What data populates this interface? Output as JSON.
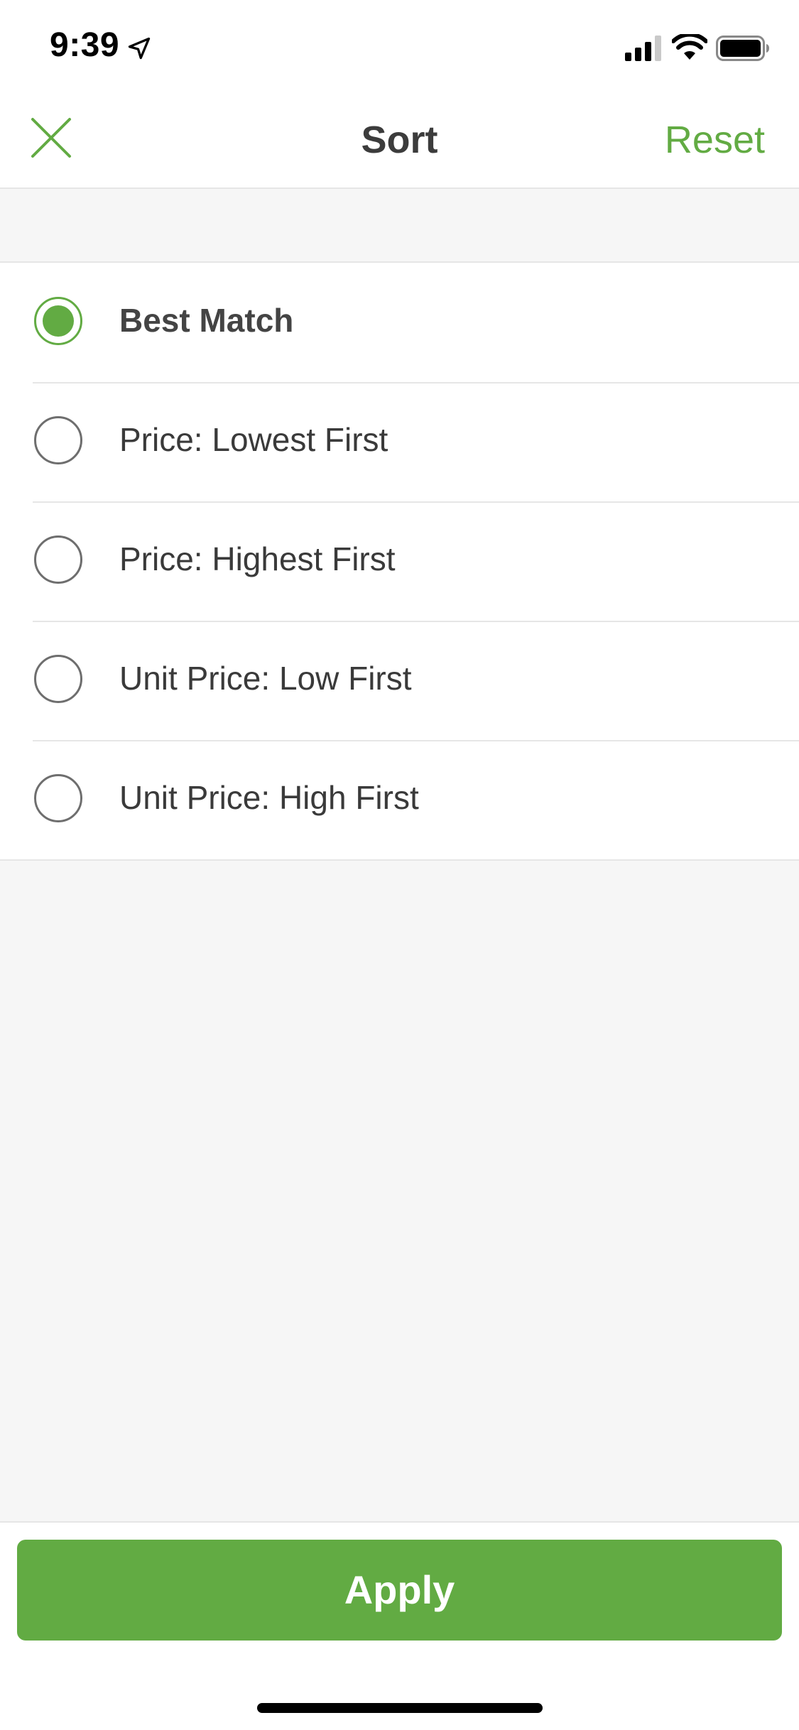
{
  "status_bar": {
    "time": "9:39"
  },
  "nav": {
    "title": "Sort",
    "reset_label": "Reset"
  },
  "sort_options": [
    {
      "label": "Best Match",
      "selected": true
    },
    {
      "label": "Price: Lowest First",
      "selected": false
    },
    {
      "label": "Price: Highest First",
      "selected": false
    },
    {
      "label": "Unit Price: Low First",
      "selected": false
    },
    {
      "label": "Unit Price: High First",
      "selected": false
    }
  ],
  "footer": {
    "apply_label": "Apply"
  },
  "colors": {
    "accent": "#62ab43",
    "text": "#3a3a3a",
    "background": "#f6f6f6",
    "divider": "#e6e6e6"
  }
}
